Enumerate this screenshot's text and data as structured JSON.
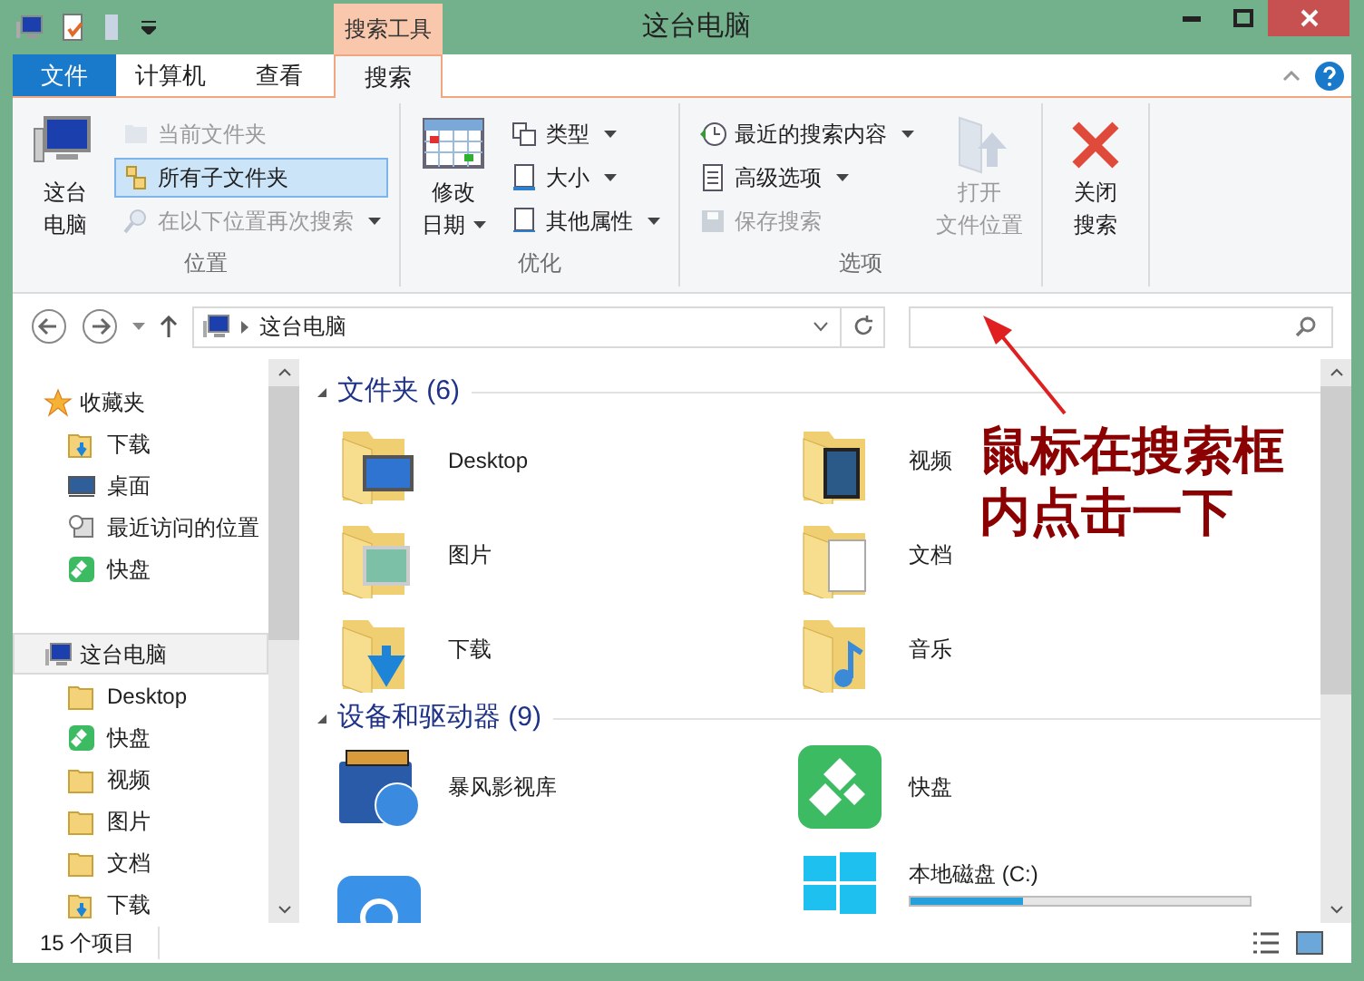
{
  "window": {
    "title": "这台电脑",
    "context_tab_group": "搜索工具"
  },
  "tabs": [
    {
      "label": "文件",
      "kind": "file",
      "selected": false
    },
    {
      "label": "计算机",
      "kind": "tab",
      "selected": false
    },
    {
      "label": "查看",
      "kind": "tab",
      "selected": false
    },
    {
      "label": "搜索",
      "kind": "tab",
      "selected": true
    }
  ],
  "ribbon_groups": [
    {
      "label": "位置",
      "buttons": [
        {
          "kind": "large",
          "lines": [
            "这台",
            "电脑"
          ],
          "disabled": false,
          "dropdown": false
        },
        {
          "kind": "small",
          "label": "当前文件夹",
          "disabled": true,
          "selected": false,
          "dropdown": false
        },
        {
          "kind": "small",
          "label": "所有子文件夹",
          "disabled": false,
          "selected": true,
          "dropdown": false
        },
        {
          "kind": "small",
          "label": "在以下位置再次搜索",
          "disabled": true,
          "selected": false,
          "dropdown": true
        }
      ]
    },
    {
      "label": "优化",
      "buttons": [
        {
          "kind": "large",
          "lines": [
            "修改",
            "日期"
          ],
          "disabled": false,
          "dropdown": true
        },
        {
          "kind": "small",
          "label": "类型",
          "disabled": false,
          "selected": false,
          "dropdown": true
        },
        {
          "kind": "small",
          "label": "大小",
          "disabled": false,
          "selected": false,
          "dropdown": true
        },
        {
          "kind": "small",
          "label": "其他属性",
          "disabled": false,
          "selected": false,
          "dropdown": true
        }
      ]
    },
    {
      "label": "选项",
      "buttons": [
        {
          "kind": "small",
          "label": "最近的搜索内容",
          "disabled": false,
          "selected": false,
          "dropdown": true
        },
        {
          "kind": "small",
          "label": "高级选项",
          "disabled": false,
          "selected": false,
          "dropdown": true
        },
        {
          "kind": "small",
          "label": "保存搜索",
          "disabled": true,
          "selected": false,
          "dropdown": false
        },
        {
          "kind": "large",
          "lines": [
            "打开",
            "文件位置"
          ],
          "disabled": true,
          "dropdown": false
        }
      ]
    },
    {
      "buttons": [
        {
          "kind": "large",
          "lines": [
            "关闭",
            "搜索"
          ],
          "disabled": false,
          "dropdown": false
        }
      ]
    }
  ],
  "address": {
    "path": "这台电脑"
  },
  "nav_pane": [
    {
      "label": "收藏夹",
      "selected": false,
      "children": [
        {
          "label": "下载"
        },
        {
          "label": "桌面"
        },
        {
          "label": "最近访问的位置"
        },
        {
          "label": "快盘"
        }
      ]
    },
    {
      "label": "这台电脑",
      "selected": true,
      "children": [
        {
          "label": "Desktop"
        },
        {
          "label": "快盘"
        },
        {
          "label": "视频"
        },
        {
          "label": "图片"
        },
        {
          "label": "文档"
        },
        {
          "label": "下载"
        }
      ]
    }
  ],
  "content_groups": [
    {
      "title": "文件夹 (6)",
      "items": [
        {
          "label": "Desktop"
        },
        {
          "label": "视频"
        },
        {
          "label": "图片"
        },
        {
          "label": "文档"
        },
        {
          "label": "下载"
        },
        {
          "label": "音乐"
        }
      ]
    },
    {
      "title": "设备和驱动器 (9)",
      "items": [
        {
          "label": "暴风影视库"
        },
        {
          "label": "快盘"
        },
        {
          "kind": "partial"
        },
        {
          "label": "本地磁盘 (C:)",
          "level": 0.33
        }
      ]
    }
  ],
  "annotation": {
    "text": "鼠标在搜索框内点击一下"
  },
  "status_bar": {
    "count": "15 个项目"
  }
}
